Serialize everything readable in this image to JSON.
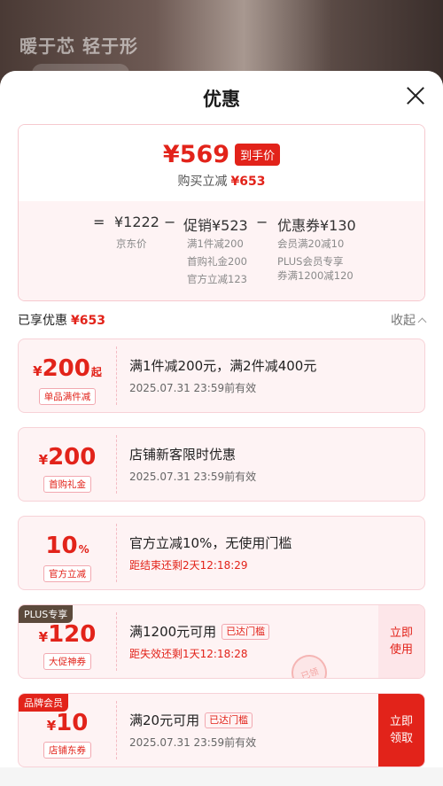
{
  "background": {
    "slogan": "暖于芯 轻于形"
  },
  "sheet": {
    "title": "优惠"
  },
  "summary": {
    "final_price": "¥569",
    "final_tag": "到手价",
    "saved_label": "购买立减",
    "saved_amount": "¥653",
    "formula": {
      "eq": "=",
      "base": "¥1222",
      "minus1": "−",
      "promo": "促销¥523",
      "minus2": "−",
      "coupon": "优惠券¥130"
    },
    "base_label": "京东价",
    "promo_lines": [
      "满1件减200",
      "首购礼金200",
      "官方立减123"
    ],
    "coupon_lines": [
      "会员满20减10",
      "PLUS会员专享",
      "券满1200减120"
    ]
  },
  "enjoyed": {
    "label": "已享优惠",
    "amount": "¥653",
    "collapse": "收起"
  },
  "coupons": [
    {
      "symbol": "¥",
      "amount": "200",
      "unit": "起",
      "tag": "单品满件减",
      "desc": "满1件减200元，满2件减400元",
      "time": "2025.07.31 23:59前有效"
    },
    {
      "symbol": "¥",
      "amount": "200",
      "unit": "",
      "tag": "首购礼金",
      "desc": "店铺新客限时优惠",
      "time": "2025.07.31 23:59前有效"
    },
    {
      "symbol": "",
      "amount": "10",
      "unit": "%",
      "tag": "官方立减",
      "desc": "官方立减10%，无使用门槛",
      "time": "距结束还剩2天12:18:29"
    },
    {
      "badge": "PLUS专享",
      "symbol": "¥",
      "amount": "120",
      "unit": "",
      "tag": "大促神券",
      "desc": "满1200元可用",
      "req": "已达门槛",
      "time": "距失效还剩1天12:18:28",
      "action": "立即使用",
      "stamp": "已领"
    },
    {
      "badge": "品牌会员",
      "symbol": "¥",
      "amount": "10",
      "unit": "",
      "tag": "店铺东券",
      "desc": "满20元可用",
      "req": "已达门槛",
      "time": "2025.07.31 23:59前有效",
      "action": "立即领取"
    }
  ],
  "colors": {
    "accent": "#e2231a",
    "card_bg": "#fef3f4"
  }
}
